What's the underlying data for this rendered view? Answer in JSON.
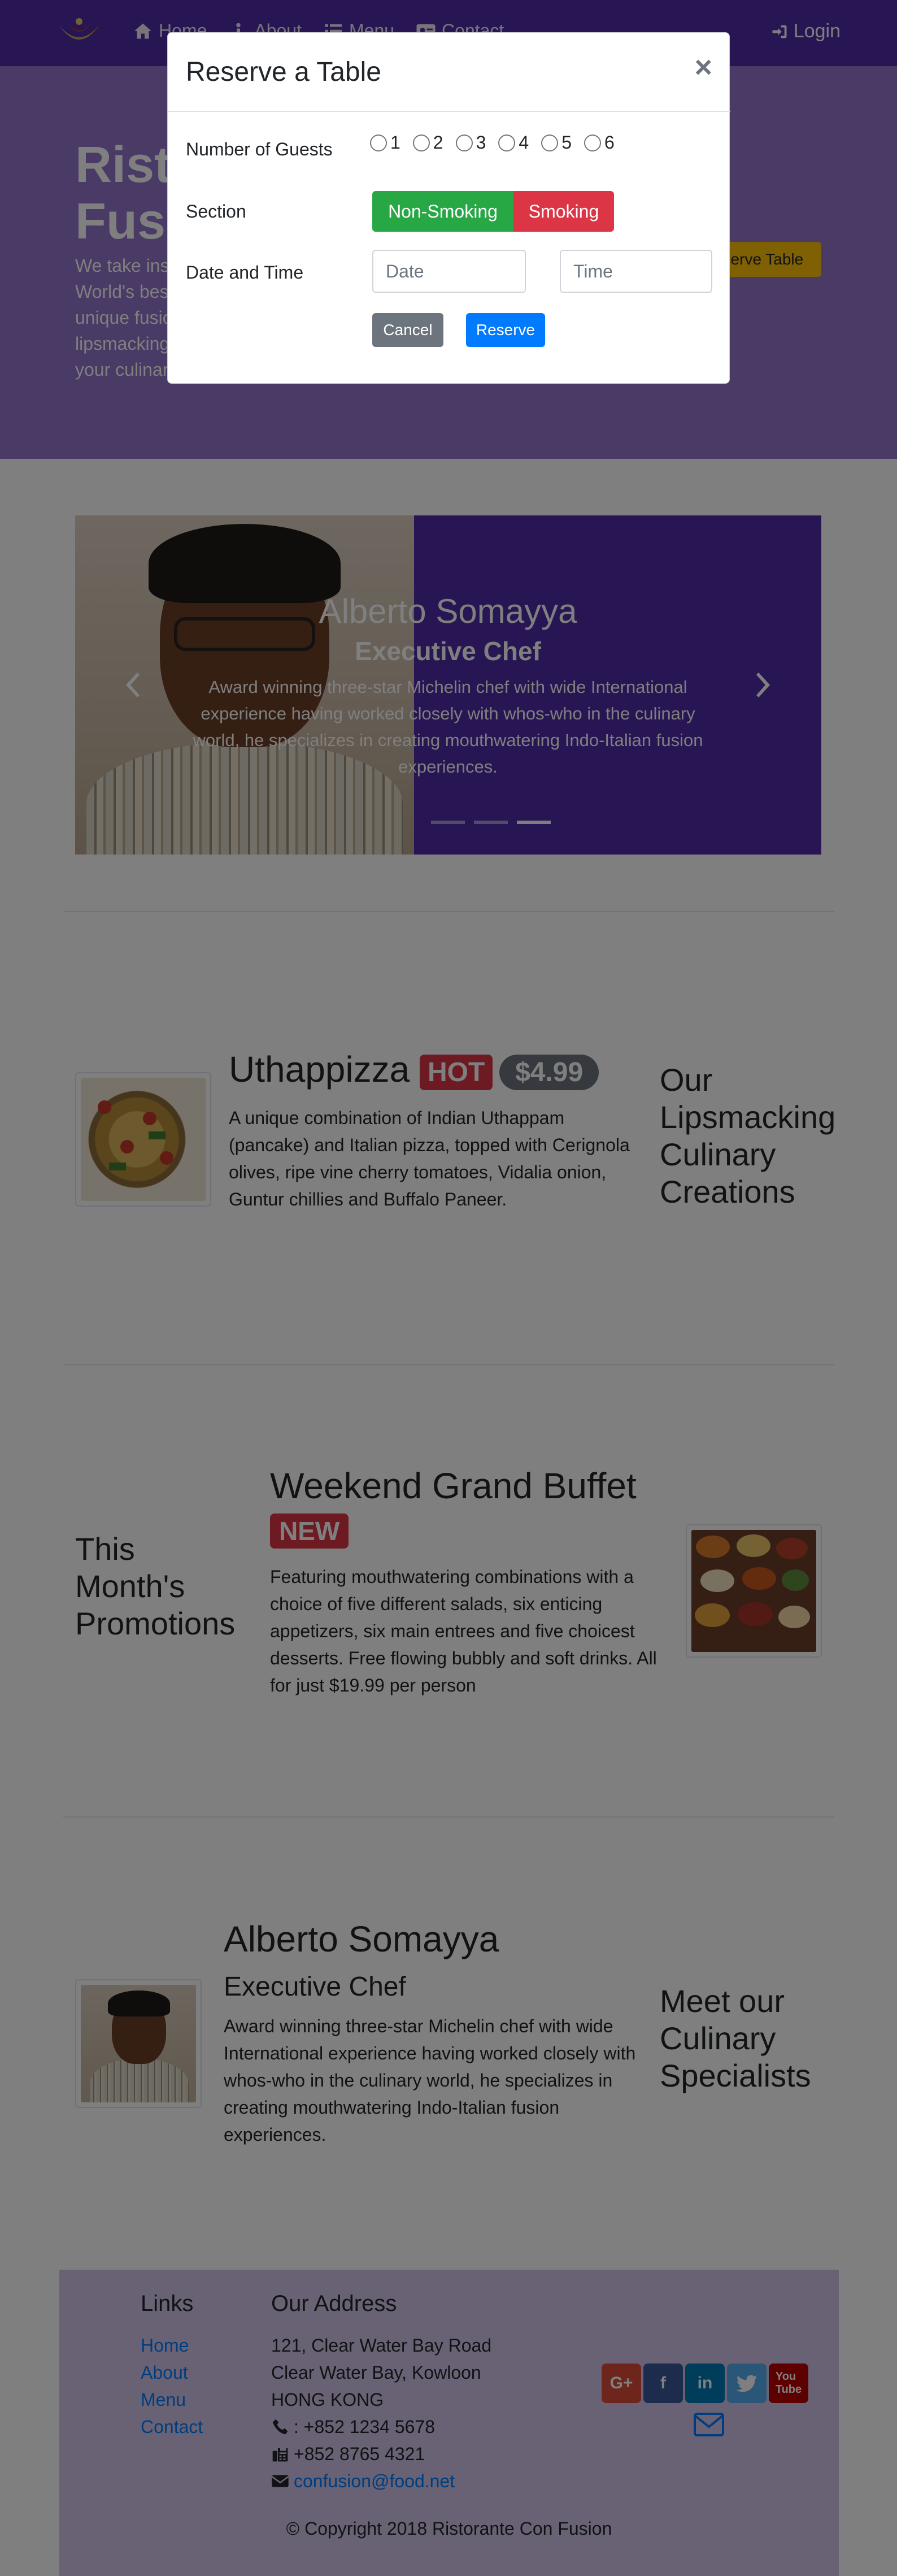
{
  "navbar": {
    "links": [
      {
        "label": "Home",
        "icon": "home-icon"
      },
      {
        "label": "About",
        "icon": "info-icon"
      },
      {
        "label": "Menu",
        "icon": "list-icon"
      },
      {
        "label": "Contact",
        "icon": "address-card-icon"
      }
    ],
    "login_label": "Login"
  },
  "jumbotron": {
    "title": "Ristorante Con Fusion",
    "text": "We take inspiration from the World's best cuisines, and create a unique fusion experience. Our lipsmacking creations will tickle your culinary senses!",
    "button_label": "Reserve Table"
  },
  "carousel": {
    "name": "Alberto Somayya",
    "role": "Executive Chef",
    "description": "Award winning three-star Michelin chef with wide International experience having worked closely with whos-who in the culinary world, he specializes in creating mouthwatering Indo-Italian fusion experiences."
  },
  "dish": {
    "title": "Uthappizza",
    "badge": "HOT",
    "price": "$4.99",
    "description": "A unique combination of Indian Uthappam (pancake) and Italian pizza, topped with Cerignola olives, ripe vine cherry tomatoes, Vidalia onion, Guntur chillies and Buffalo Paneer.",
    "side_heading": "Our Lipsmacking Culinary Creations"
  },
  "promotion": {
    "side_heading": "This Month's Promotions",
    "title": "Weekend Grand Buffet",
    "badge": "NEW",
    "description": "Featuring mouthwatering combinations with a choice of five different salads, six enticing appetizers, six main entrees and five choicest desserts. Free flowing bubbly and soft drinks. All for just $19.99 per person"
  },
  "leader": {
    "name": "Alberto Somayya",
    "role": "Executive Chef",
    "description": "Award winning three-star Michelin chef with wide International experience having worked closely with whos-who in the culinary world, he specializes in creating mouthwatering Indo-Italian fusion experiences.",
    "side_heading": "Meet our Culinary Specialists"
  },
  "footer": {
    "links_title": "Links",
    "links": [
      "Home",
      "About",
      "Menu",
      "Contact"
    ],
    "address_title": "Our Address",
    "address_lines": [
      "121, Clear Water Bay Road",
      "Clear Water Bay, Kowloon",
      "HONG KONG"
    ],
    "phone": ": +852 1234 5678",
    "fax": "+852 8765 4321",
    "email": "confusion@food.net",
    "copyright": "© Copyright 2018 Ristorante Con Fusion"
  },
  "modal": {
    "title": "Reserve a Table",
    "close": "×",
    "guests_label": "Number of Guests",
    "guest_options": [
      "1",
      "2",
      "3",
      "4",
      "5",
      "6"
    ],
    "section_label": "Section",
    "non_smoking_label": "Non-Smoking",
    "smoking_label": "Smoking",
    "datetime_label": "Date and Time",
    "date_placeholder": "Date",
    "time_placeholder": "Time",
    "cancel_label": "Cancel",
    "reserve_label": "Reserve"
  },
  "colors": {
    "primary_dark": "#512da8",
    "primary": "#9575cd",
    "footer_bg": "#d1c4e9",
    "success": "#28a745",
    "danger": "#dc3545",
    "secondary": "#6c757d",
    "link": "#007bff",
    "warning": "#ffc107"
  }
}
